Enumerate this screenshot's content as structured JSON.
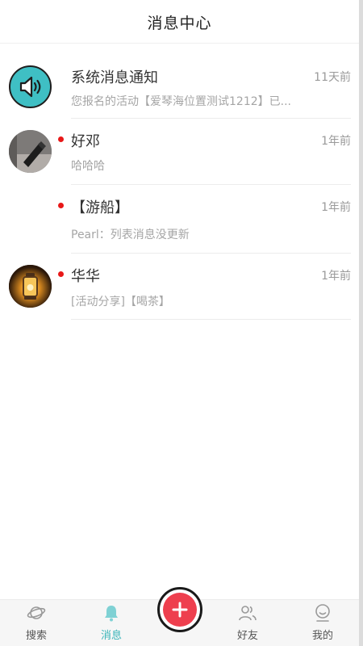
{
  "header": {
    "title": "消息中心"
  },
  "messages": [
    {
      "name": "系统消息通知",
      "time": "11天前",
      "preview": "您报名的活动【爱琴海位置测试1212】已...",
      "unread": false,
      "avatar": "speaker-icon"
    },
    {
      "name": "好邓",
      "time": "1年前",
      "preview": "哈哈哈",
      "unread": true,
      "avatar": "user-photo-dark"
    },
    {
      "name": "【游船】",
      "time": "1年前",
      "preview": "Pearl：列表消息没更新",
      "unread": true,
      "avatar": "none"
    },
    {
      "name": "华华",
      "time": "1年前",
      "preview": "[活动分享]【喝茶】",
      "unread": true,
      "avatar": "user-photo-lantern"
    }
  ],
  "tabbar": {
    "tabs": [
      {
        "label": "搜索",
        "icon": "planet-icon",
        "active": false
      },
      {
        "label": "消息",
        "icon": "bell-icon",
        "active": true
      },
      {
        "label": "好友",
        "icon": "friends-icon",
        "active": false
      },
      {
        "label": "我的",
        "icon": "profile-icon",
        "active": false
      }
    ],
    "center_action": "add-icon"
  },
  "colors": {
    "accent": "#38b4b8",
    "unread_dot": "#e81818",
    "fab": "#ee3f4e"
  }
}
